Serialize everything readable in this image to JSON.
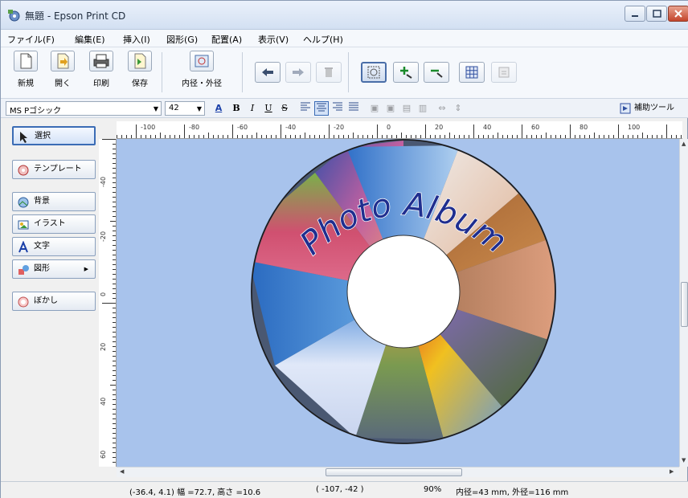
{
  "window": {
    "title": "無題 - Epson Print CD"
  },
  "menu": {
    "items": [
      "ファイル(F)",
      "編集(E)",
      "挿入(I)",
      "図形(G)",
      "配置(A)",
      "表示(V)",
      "ヘルプ(H)"
    ]
  },
  "toolbar": {
    "new_label": "新規",
    "open_label": "開く",
    "print_label": "印刷",
    "save_label": "保存",
    "diameter_label": "内径・外径"
  },
  "format": {
    "font_name": "MS Pゴシック",
    "font_size": "42",
    "bold": "B",
    "italic": "I",
    "underline": "U",
    "strike": "S",
    "assist_tool_label": "補助ツール"
  },
  "left_panel": {
    "select_label": "選択",
    "template_label": "テンプレート",
    "background_label": "背景",
    "illust_label": "イラスト",
    "text_label": "文字",
    "shape_label": "図形",
    "blur_label": "ぼかし"
  },
  "rulers": {
    "h_ticks": [
      "-100",
      "-80",
      "-60",
      "-40",
      "-20",
      "0",
      "20",
      "40",
      "60",
      "80",
      "100"
    ],
    "v_ticks": [
      "-40",
      "-20",
      "0",
      "20",
      "40",
      "60"
    ]
  },
  "disc": {
    "title_text": "Photo Album"
  },
  "status": {
    "selection_info": "(-36.4, 4.1) 幅 =72.7, 高さ =10.6",
    "cursor_pos": "( -107, -42 )",
    "zoom": "90%",
    "diameter_info": "内径=43 mm, 外径=116 mm"
  },
  "colors": {
    "canvas": "#a8c3ec",
    "disc_ring": "#4a5872",
    "title_text": "#1f2e8f"
  }
}
